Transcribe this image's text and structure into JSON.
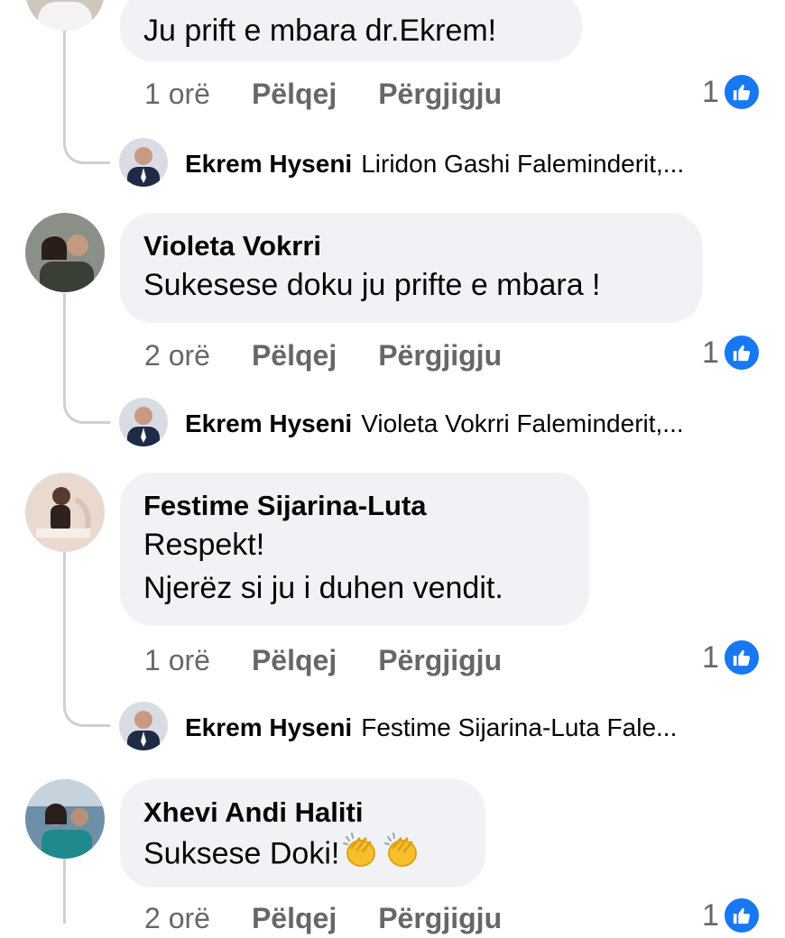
{
  "comments": [
    {
      "author": "",
      "text": "Ju prift e mbara dr.Ekrem!",
      "time": "1 orë",
      "like_label": "Pëlqej",
      "reply_label": "Përgjigju",
      "reaction_count": "1",
      "reply": {
        "author": "Ekrem Hyseni",
        "text": "Liridon Gashi Faleminderit,..."
      }
    },
    {
      "author": "Violeta Vokrri",
      "text": "Sukesese doku ju prifte e mbara !",
      "time": "2 orë",
      "like_label": "Pëlqej",
      "reply_label": "Përgjigju",
      "reaction_count": "1",
      "reply": {
        "author": "Ekrem Hyseni",
        "text": "Violeta Vokrri Faleminderit,..."
      }
    },
    {
      "author": "Festime Sijarina-Luta",
      "text": "Respekt!\nNjerëz si ju i duhen vendit.",
      "time": "1 orë",
      "like_label": "Pëlqej",
      "reply_label": "Përgjigju",
      "reaction_count": "1",
      "reply": {
        "author": "Ekrem Hyseni",
        "text": "Festime Sijarina-Luta Fale..."
      }
    },
    {
      "author": "Xhevi Andi Haliti",
      "text": "Suksese Doki!",
      "emoji": [
        "clapping-hands",
        "clapping-hands"
      ],
      "time": "2 orë",
      "like_label": "Pëlqej",
      "reply_label": "Përgjigju",
      "reaction_count": "1"
    }
  ],
  "colors": {
    "bubble": "#f0f2f5",
    "meta_text": "#65676b",
    "like_blue": "#1877f2",
    "thread_line": "#ced0d4"
  },
  "icons": {
    "reaction": "like-thumbs-up-icon",
    "emoji": "clapping-hands-icon"
  }
}
